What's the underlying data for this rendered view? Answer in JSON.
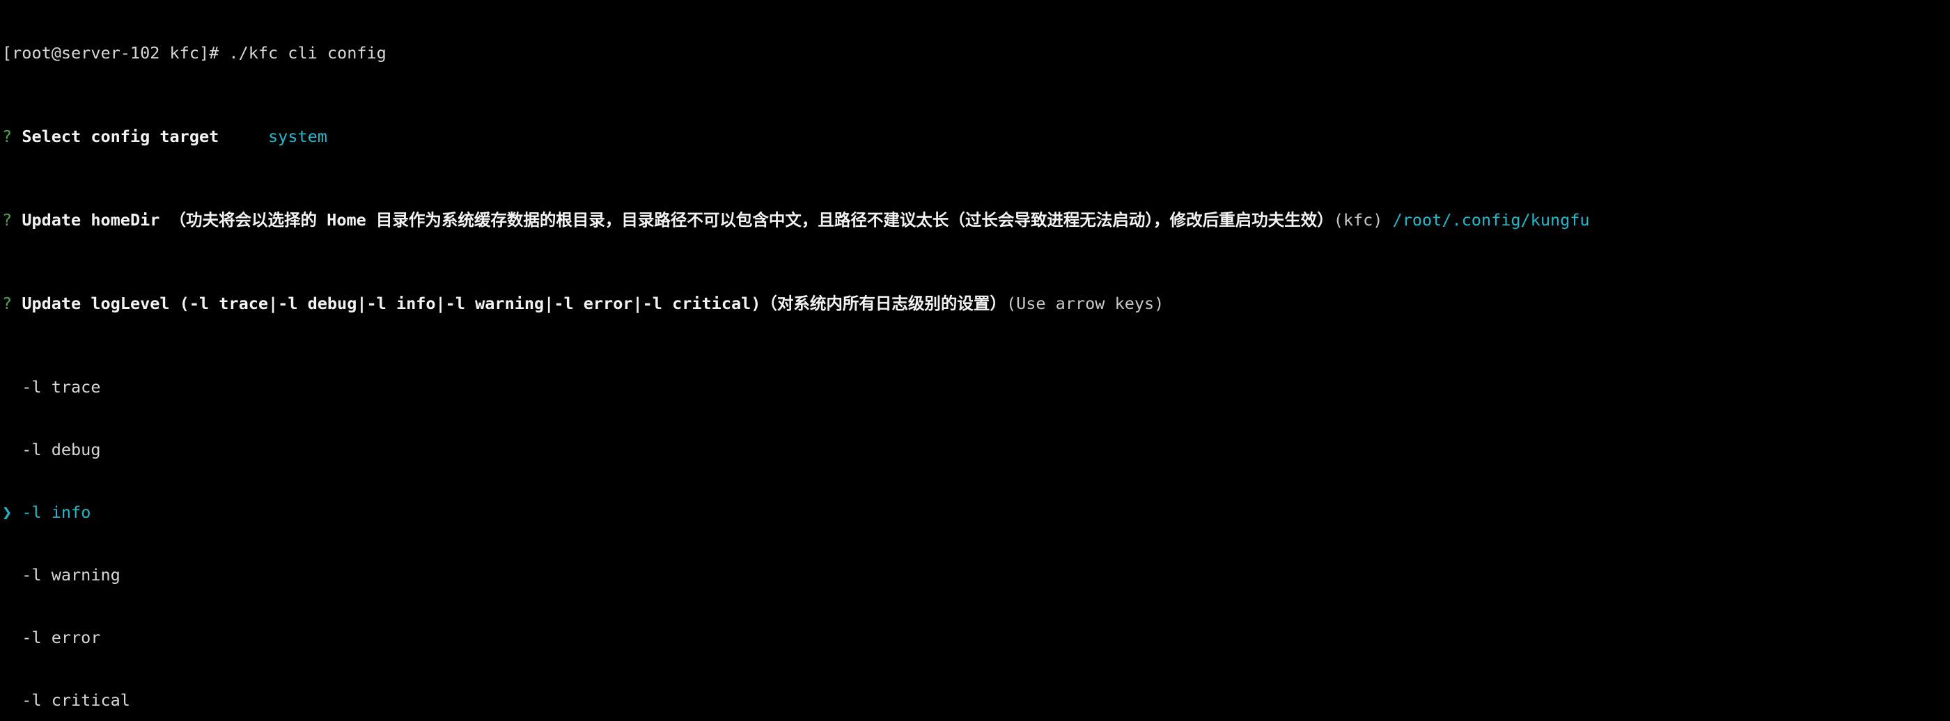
{
  "colors": {
    "background": "#000000",
    "text": "#d7d7d7",
    "question_mark": "#4fa24f",
    "accent": "#25b7c9"
  },
  "terminal": {
    "prompt": "[root@server-102 kfc]# ",
    "command": "./kfc cli config",
    "q1": {
      "mark": "?",
      "label": "Select config target",
      "answer": "system"
    },
    "q2": {
      "mark": "?",
      "label": "Update homeDir （功夫将会以选择的 Home 目录作为系统缓存数据的根目录，目录路径不可以包含中文，且路径不建议太长（过长会导致进程无法启动），修改后重启功夫生效）",
      "default": "(kfc)",
      "answer": "/root/.config/kungfu"
    },
    "q3": {
      "mark": "?",
      "label": "Update logLevel (-l trace|-l debug|-l info|-l warning|-l error|-l critical)（对系统内所有日志级别的设置）",
      "hint": "(Use arrow keys)"
    },
    "pointer_symbol": "❯",
    "options": [
      "-l trace",
      "-l debug",
      "-l info",
      "-l warning",
      "-l error",
      "-l critical"
    ]
  }
}
